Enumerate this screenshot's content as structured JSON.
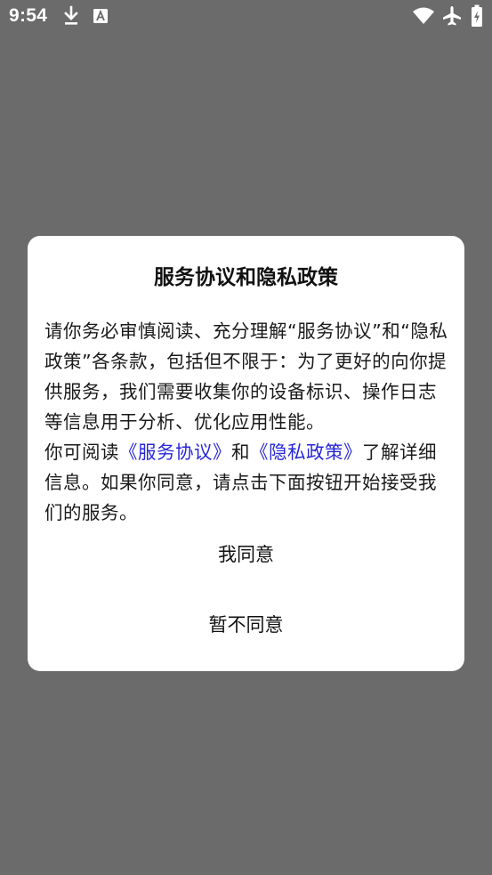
{
  "status_bar": {
    "time": "9:54",
    "icons": [
      "download-icon",
      "font-a-icon",
      "wifi-icon",
      "airplane-mode-icon",
      "battery-icon"
    ]
  },
  "dialog": {
    "title": "服务协议和隐私政策",
    "paragraph1": "请你务必审慎阅读、充分理解“服务协议”和“隐私政策”各条款，包括但不限于：为了更好的向你提供服务，我们需要收集你的设备标识、操作日志等信息用于分析、优化应用性能。",
    "paragraph2": {
      "prefix": "你可阅读",
      "service_link": "《服务协议》",
      "connector": "和",
      "privacy_link": "《隐私政策》",
      "suffix": "了解详细信息。如果你同意，请点击下面按钮开始接受我们的服务。"
    },
    "agree_label": "我同意",
    "disagree_label": "暂不同意"
  },
  "colors": {
    "backdrop": "#6b6b6b",
    "dialog_background": "#ffffff",
    "link": "#2727d8",
    "text": "#1a1a1a"
  }
}
